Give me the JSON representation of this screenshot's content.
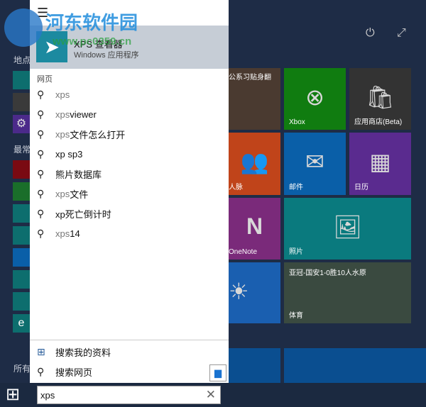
{
  "watermark": {
    "title": "河东软件园",
    "url": "www.pc0359.cn"
  },
  "left_strip": {
    "places": "地点",
    "most_used": "最常",
    "all_apps": "所有"
  },
  "best_match": {
    "name": "XPS 查看器",
    "subtitle": "Windows 应用程序"
  },
  "section_web": "网页",
  "suggestions": [
    {
      "q": "xps",
      "rest": ""
    },
    {
      "q": "xps",
      "rest": " viewer"
    },
    {
      "q": "xps",
      "rest": "文件怎么打开"
    },
    {
      "q": "",
      "rest": "xp sp3"
    },
    {
      "q": "",
      "rest": "熊片数据库"
    },
    {
      "q": "xps",
      "rest": "文件"
    },
    {
      "q": "",
      "rest": "xp死亡倒计时"
    },
    {
      "q": "xps",
      "rest": "14"
    }
  ],
  "bottom_actions": {
    "my_stuff": "搜索我的资料",
    "web": "搜索网页"
  },
  "search": {
    "value": "xps"
  },
  "tiles": {
    "news": "公系习贴身翻",
    "xbox": "Xbox",
    "store": "应用商店(Beta)",
    "people": "人脉",
    "mail": "邮件",
    "calendar": "日历",
    "onenote": "OneNote",
    "photos": "照片",
    "sports_headline": "亚冠-国安1-0胜10人水原",
    "sports": "体育"
  },
  "colors": {
    "xbox": "#107c10",
    "store": "#333333",
    "people": "#c0441a",
    "mail": "#0a5fa8",
    "calendar": "#5a2b8f",
    "onenote": "#7a2a7a",
    "photos": "#0a7a7e",
    "weather": "#1a5fb0"
  }
}
